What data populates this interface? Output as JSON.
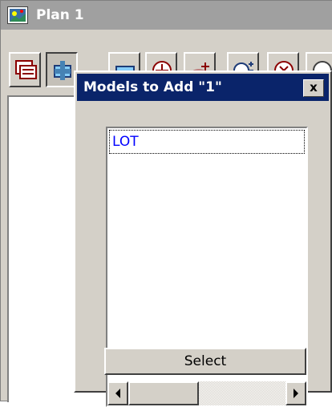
{
  "plan_window": {
    "title": "Plan 1",
    "app_icon": "plan-app-icon",
    "toolbar": [
      {
        "name": "plot-views-icon"
      },
      {
        "name": "add-model-icon",
        "pressed": true
      },
      {
        "name": "remove-model-icon"
      },
      {
        "name": "pan-icon"
      },
      {
        "name": "zoom-to-models-icon"
      },
      {
        "name": "zoom-in-out-icon"
      },
      {
        "name": "zoom-extent-icon"
      },
      {
        "name": "clean-icon"
      }
    ]
  },
  "dialog": {
    "title": "Models to Add \"1\"",
    "close_label": "x",
    "list": {
      "items": [
        "LOT"
      ]
    },
    "select_label": "Select"
  },
  "colors": {
    "title_active": "#0a246a",
    "title_inactive": "#a0a0a0",
    "face": "#d4d0c8",
    "list_text": "#0000ff"
  }
}
